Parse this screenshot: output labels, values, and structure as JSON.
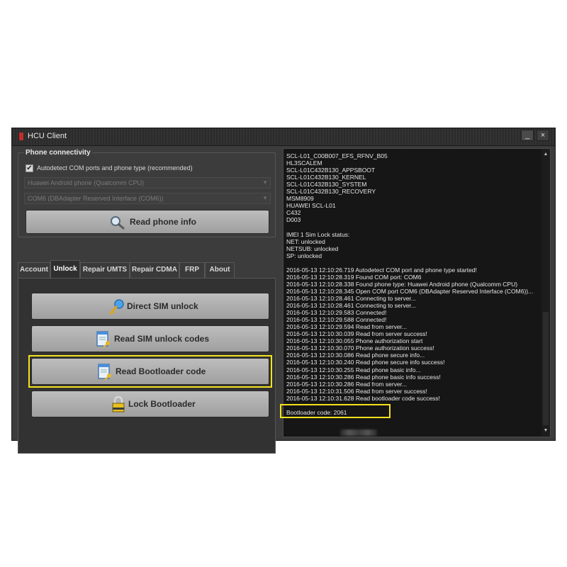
{
  "window": {
    "title": "HCU Client",
    "minimize_label": "_",
    "close_label": "×"
  },
  "connectivity": {
    "group_title": "Phone connectivity",
    "autodetect_checked": true,
    "autodetect_label": "Autodetect COM ports and phone type (recommended)",
    "phone_type_value": "Huawei Android phone (Qualcomm CPU)",
    "com_port_value": "COM6 (DBAdapter Reserved Interface (COM6))",
    "read_info_label": "Read phone info",
    "read_info_icon": "magnifier-icon"
  },
  "tabs": [
    {
      "label": "Account",
      "active": false
    },
    {
      "label": "Unlock",
      "active": true
    },
    {
      "label": "Repair UMTS",
      "active": false
    },
    {
      "label": "Repair CDMA",
      "active": false
    },
    {
      "label": "FRP",
      "active": false
    },
    {
      "label": "About",
      "active": false
    }
  ],
  "unlock_buttons": [
    {
      "label": "Direct SIM unlock",
      "icon": "key-icon"
    },
    {
      "label": "Read SIM unlock codes",
      "icon": "document-key-icon"
    },
    {
      "label": "Read Bootloader code",
      "icon": "document-key-icon"
    },
    {
      "label": "Lock Bootloader",
      "icon": "padlock-icon"
    }
  ],
  "highlighted_button": "Read Bootloader code",
  "log_lines": [
    "SCL-L01_C00B007_EFS_RFNV_B05",
    "HL3SCALEM",
    "SCL-L01C432B130_APPSBOOT",
    "SCL-L01C432B130_KERNEL",
    "SCL-L01C432B130_SYSTEM",
    "SCL-L01C432B130_RECOVERY",
    "MSM8909",
    "HUAWEI SCL-L01",
    "C432",
    "D003",
    "",
    "IMEI 1 Sim Lock status:",
    "NET: unlocked",
    "NETSUB: unlocked",
    "SP: unlocked",
    "",
    "2016-05-13 12:10:26.719 Autodetect COM port and phone type started!",
    "2016-05-13 12:10:28.319 Found COM port: COM6",
    "2016-05-13 12:10:28.338 Found phone type: Huawei Android phone (Qualcomm CPU)",
    "2016-05-13 12:10:28.345 Open COM port COM6 (DBAdapter Reserved Interface (COM6))...",
    "2016-05-13 12:10:28.461 Connecting to server...",
    "2016-05-13 12:10:28.461 Connecting to server...",
    "2016-05-13 12:10:29.583 Connected!",
    "2016-05-13 12:10:29.588 Connected!",
    "2016-05-13 12:10:29.594 Read from server...",
    "2016-05-13 12:10:30.039 Read from server success!",
    "2016-05-13 12:10:30.055 Phone authorization start",
    "2016-05-13 12:10:30.070 Phone authorization success!",
    "2016-05-13 12:10:30.086 Read phone secure info...",
    "2016-05-13 12:10:30.240 Read phone secure info success!",
    "2016-05-13 12:10:30.255 Read phone basic info...",
    "2016-05-13 12:10:30.286 Read phone basic info success!",
    "2016-05-13 12:10:30.286 Read from server...",
    "2016-05-13 12:10:31.506 Read from server success!",
    "2016-05-13 12:10:31.628 Read bootloader code success!",
    "",
    "Bootloader code: 2061"
  ],
  "colors": {
    "highlight": "#f4e21d",
    "log_background": "#161616",
    "window_background": "#3c3c3c"
  }
}
